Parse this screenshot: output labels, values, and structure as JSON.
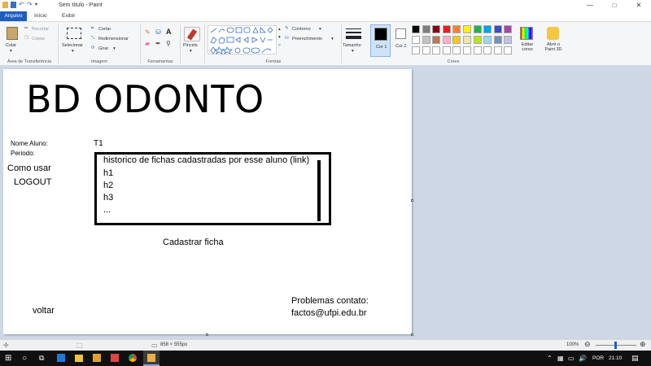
{
  "window": {
    "title": "Sem título - Paint",
    "min": "—",
    "max": "□",
    "close": "✕"
  },
  "tabs": {
    "file": "Arquivo",
    "home": "Início",
    "view": "Exibir"
  },
  "ribbon": {
    "clipboard": {
      "paste": "Colar",
      "cut": "Recortar",
      "copy": "Copiar",
      "group": "Área de Transferência"
    },
    "image": {
      "select": "Selecionar",
      "crop": "Cortar",
      "resize": "Redimensionar",
      "rotate": "Girar",
      "group": "Imagem"
    },
    "tools": {
      "group": "Ferramentas"
    },
    "brushes": {
      "label": "Pincéis"
    },
    "shapes": {
      "outline": "Contorno",
      "fill": "Preenchimento",
      "group": "Formas"
    },
    "size": {
      "label": "Tamanho"
    },
    "colors": {
      "color1": "Cor 1",
      "color2": "Cor 2",
      "edit": "Editar cores",
      "paint3d": "Abrir o Paint 3D",
      "group": "Cores",
      "palette": [
        "#000000",
        "#7f7f7f",
        "#880015",
        "#ed1c24",
        "#ff7f27",
        "#fff200",
        "#22b14c",
        "#00a2e8",
        "#3f48cc",
        "#a349a4",
        "#ffffff",
        "#c3c3c3",
        "#b97a57",
        "#ffaec9",
        "#ffc90e",
        "#efe4b0",
        "#b5e61d",
        "#99d9ea",
        "#7092be",
        "#c8bfe7",
        "#ffffff",
        "#ffffff",
        "#ffffff",
        "#ffffff",
        "#ffffff",
        "#ffffff",
        "#ffffff",
        "#ffffff",
        "#ffffff",
        "#ffffff"
      ]
    }
  },
  "canvas": {
    "heading": "BD ODONTO",
    "field_name_label": "Nome Aluno:",
    "field_name_value": "T1",
    "field_period_label": "Periodo:",
    "link_how_to_use": "Como usar",
    "link_logout": "LOGOUT",
    "history_title": "historico de fichas cadastradas por esse aluno (link)",
    "history_items": [
      "h1",
      "h2",
      "h3",
      "..."
    ],
    "register_link": "Cadastrar ficha",
    "back_link": "voltar",
    "contact_title": "Problemas contato:",
    "contact_email": "factos@ufpi.edu.br"
  },
  "statusbar": {
    "dimensions": "858 × 555px",
    "zoom": "100%"
  },
  "taskbar": {
    "lang": "POR",
    "time": "21:10"
  }
}
